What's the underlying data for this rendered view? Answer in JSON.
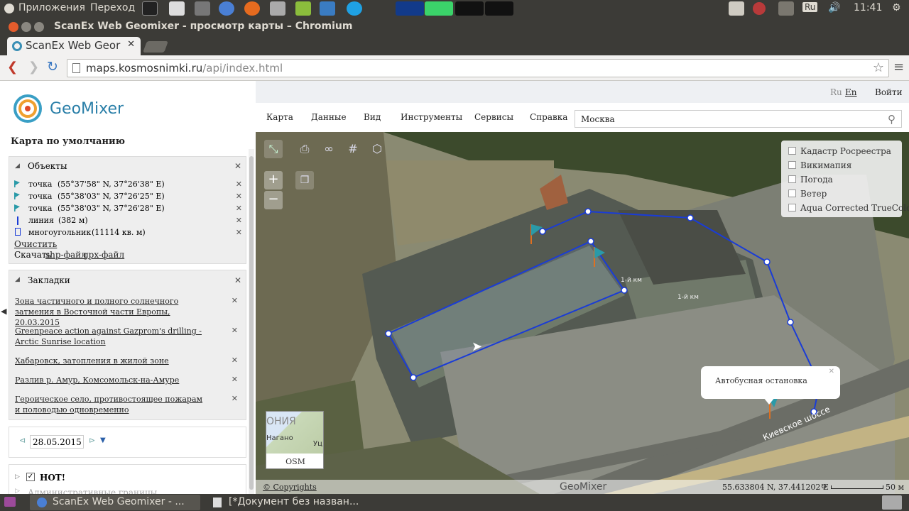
{
  "system_bar": {
    "apps_label": "Приложения",
    "places_label": "Переход",
    "lang": "Ru",
    "clock": "11:41"
  },
  "window": {
    "title": "ScanEx Web Geomixer - просмотр карты – Chromium"
  },
  "browser": {
    "tab_title": "ScanEx Web Geor",
    "url_host": "maps.kosmosnimki.ru",
    "url_path": "/api/index.html"
  },
  "header": {
    "logo_text": "GeoMixer",
    "lang_ru": "Ru",
    "lang_en": "En",
    "login": "Войти"
  },
  "menu": {
    "items": [
      "Карта",
      "Данные",
      "Вид",
      "Инструменты",
      "Сервисы",
      "Справка"
    ],
    "search_value": "Москва"
  },
  "sidebar": {
    "map_title": "Карта по умолчанию",
    "objects": {
      "title": "Объекты",
      "items": [
        {
          "type": "точка",
          "info": "(55°37'58\" N, 37°26'38\" E)"
        },
        {
          "type": "точка",
          "info": "(55°38'03\" N, 37°26'25\" E)"
        },
        {
          "type": "точка",
          "info": "(55°38'03\" N, 37°26'28\" E)"
        },
        {
          "type": "линия",
          "info": "(382 м)"
        },
        {
          "type": "многоугольник",
          "info": "(11114 кв. м)"
        }
      ],
      "clear": "Очистить",
      "download_label": "Скачать",
      "shp": "shp-файл",
      "gpx": "gpx-файл"
    },
    "bookmarks": {
      "title": "Закладки",
      "items": [
        "Зона частичного и полного солнечного затмения в Восточной части Европы, 20.03.2015",
        "Greenpeace action against Gazprom's drilling - Arctic Sunrise location",
        "Хабаровск, затопления в жилой зоне",
        "Разлив р. Амур, Комсомольск-на-Амуре",
        "Героическое село, противостоящее пожарам и половодью одновременно"
      ]
    },
    "date": "28.05.2015",
    "layer_hot": "HOT!",
    "layer_admin": "Административные границы"
  },
  "map": {
    "layers": [
      "Кадастр Росреестра",
      "Викимапия",
      "Погода",
      "Ветер",
      "Aqua Corrected TrueColor"
    ],
    "popup_text": "Автобусная остановка",
    "road_label": "Киевское шоссе",
    "km_label_1": "1-й км",
    "km_label_2": "1-й км",
    "minimap_label": "OSM",
    "minimap_text_1": "ОНИЯ",
    "minimap_text_2": "Нагано",
    "minimap_text_3": "Уц",
    "copyright": "© Copyrights",
    "watermark": "GeoMixer",
    "coords": "55.633804 N, 37.441202 E",
    "scale_label": "50 м"
  },
  "taskbar": {
    "items": [
      "ScanEx Web Geomixer - ...",
      "[*Документ без назван..."
    ]
  },
  "colors": {
    "accent_blue": "#1a3cd6",
    "flag_teal": "#2a9aa8"
  }
}
